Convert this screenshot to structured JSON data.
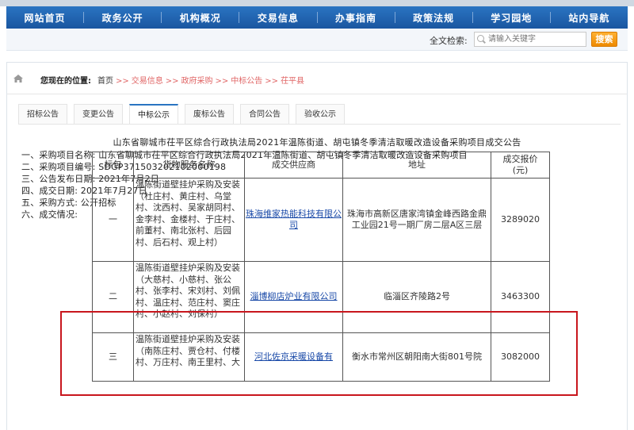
{
  "nav": {
    "items": [
      "网站首页",
      "政务公开",
      "机构概况",
      "交易信息",
      "办事指南",
      "政策法规",
      "学习园地",
      "站内导航"
    ]
  },
  "search": {
    "label": "全文检索:",
    "placeholder": "请输入关键字",
    "button": "搜索"
  },
  "breadcrumb": {
    "label": "您现在的位置:",
    "trail": [
      "首页",
      "交易信息",
      "政府采购",
      "中标公告",
      "茌平县"
    ]
  },
  "tabs": {
    "items": [
      "招标公告",
      "变更公告",
      "中标公示",
      "废标公告",
      "合同公告",
      "验收公示"
    ],
    "active_index": 2
  },
  "article": {
    "title": "山东省聊城市茌平区综合行政执法局2021年温陈街道、胡屯镇冬季清洁取暖改造设备采购项目成交公告",
    "lines": [
      "一、采购项目名称: 山东省聊城市茌平区综合行政执法局2021年温陈街道、胡屯镇冬季清洁取暖改造设备采购项目",
      "二、采购项目编号: SDGP371503202102000198",
      "三、公告发布日期: 2021年7月2日",
      "四、成交日期: 2021年7月27日",
      "五、采购方式: 公开招标",
      "六、成交情况:"
    ]
  },
  "table": {
    "headers": [
      "标包",
      "货物服务名称",
      "成交供应商",
      "地址",
      "成交报价\n(元)"
    ],
    "rows": [
      {
        "package": "一",
        "goods": "温陈街道壁挂炉采购及安装（杜庄村、黄庄村、乌堂村、沈西村、吴家胡同村、金李村、金楼村、于庄村、前董村、南北张村、后园村、后石村、观上村）",
        "supplier": "珠海维家热能科技有限公司",
        "address": "珠海市高新区唐家湾镇金峰西路金鼎工业园21号一期厂房二层A区三层",
        "price": "3289020"
      },
      {
        "package": "二",
        "goods": "温陈街道壁挂炉采购及安装（大慈村、小慈村、张公村、张李村、宋刘村、刘佩村、温庄村、范庄村、窦庄村、小赵村、刘保村）",
        "supplier": "淄博柳店炉业有限公司",
        "address": "临淄区齐陵路2号",
        "price": "3463300"
      },
      {
        "package": "三",
        "goods": "温陈街道壁挂炉采购及安装（南陈庄村、贾仓村、付楼村、万庄村、南王里村、大",
        "supplier": "河北佐京采暖设备有",
        "address": "衡水市常州区朝阳南大街801号院",
        "price": "3082000"
      }
    ]
  },
  "colors": {
    "nav_bg": "#1a56a0",
    "search_button": "#ee8a00",
    "breadcrumb_link": "#e06666",
    "highlight_box": "#c8161d",
    "supplier_link": "#1a4aa8"
  }
}
